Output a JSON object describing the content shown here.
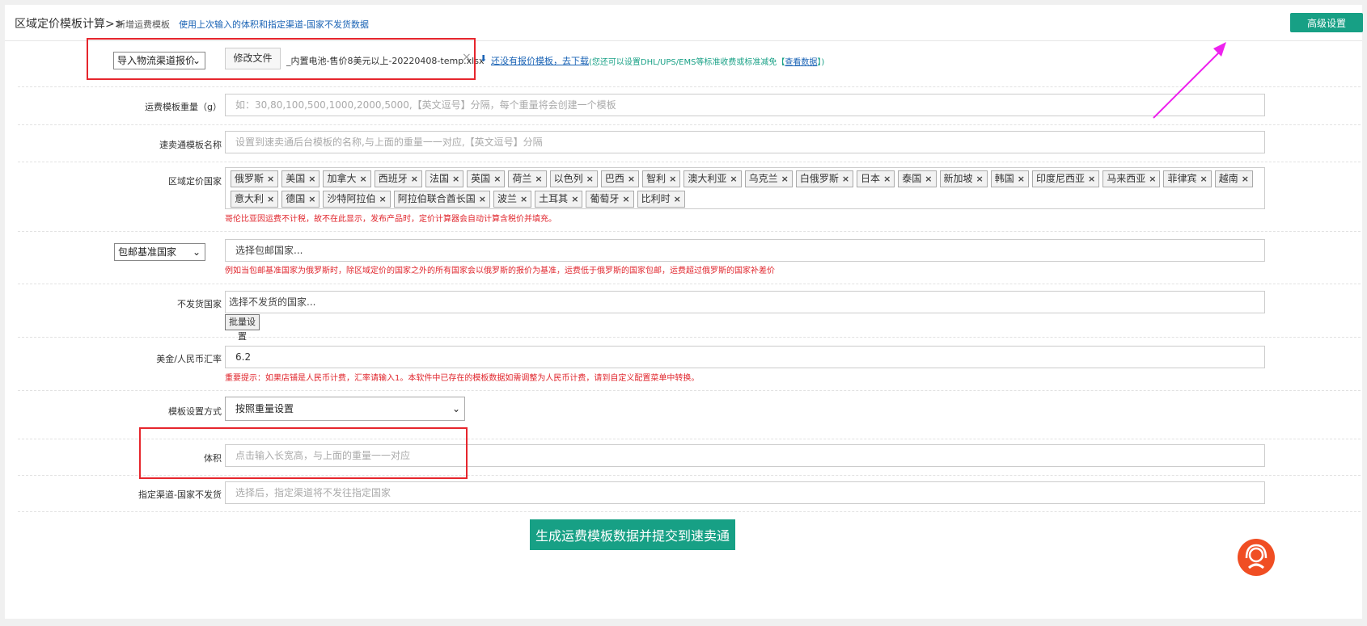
{
  "header": {
    "title": "区域定价模板计算>>",
    "sub": "新增运费模板",
    "note": "使用上次输入的体积和指定渠道-国家不发货数据",
    "advanced_button": "高级设置"
  },
  "import_row": {
    "select_value": "导入物流渠道报价",
    "file_button": "修改文件",
    "file_name": "_内置电池-售价8美元以上-20220408-temp.xlsx",
    "download_link": "还没有报价模板，去下载",
    "tip_prefix": "(您还可以设置DHL/UPS/EMS等标准收费或标准减免【",
    "tip_link": "查看数据",
    "tip_suffix": "】)"
  },
  "weight_row": {
    "label": "运费模板重量（g）",
    "placeholder": "如：30,80,100,500,1000,2000,5000,【英文逗号】分隔，每个重量将会创建一个模板"
  },
  "name_row": {
    "label": "速卖通模板名称",
    "placeholder": "设置到速卖通后台模板的名称,与上面的重量一一对应,【英文逗号】分隔"
  },
  "countries_row": {
    "label": "区域定价国家",
    "tags": [
      "俄罗斯",
      "美国",
      "加拿大",
      "西班牙",
      "法国",
      "英国",
      "荷兰",
      "以色列",
      "巴西",
      "智利",
      "澳大利亚",
      "乌克兰",
      "白俄罗斯",
      "日本",
      "泰国",
      "新加坡",
      "韩国",
      "印度尼西亚",
      "马来西亚",
      "菲律宾",
      "越南",
      "意大利",
      "德国",
      "沙特阿拉伯",
      "阿拉伯联合酋长国",
      "波兰",
      "土耳其",
      "葡萄牙",
      "比利时"
    ],
    "hint": "哥伦比亚因运费不计税，故不在此显示，发布产品时，定价计算器会自动计算含税价并填充。"
  },
  "freeship_row": {
    "select_value": "包邮基准国家",
    "placeholder": "选择包邮国家...",
    "hint": "例如当包邮基准国家为俄罗斯时，除区域定价的国家之外的所有国家会以俄罗斯的报价为基准，运费低于俄罗斯的国家包邮，运费超过俄罗斯的国家补差价"
  },
  "noship_row": {
    "label": "不发货国家",
    "placeholder": "选择不发货的国家...",
    "batch_button": "批量设置"
  },
  "rate_row": {
    "label": "美金/人民币汇率",
    "value": "6.2",
    "hint": "重要提示：如果店铺是人民币计费，汇率请输入1。本软件中已存在的模板数据如需调整为人民币计费，请到自定义配置菜单中转换。"
  },
  "mode_row": {
    "label": "模板设置方式",
    "select_value": "按照重量设置"
  },
  "volume_row": {
    "label": "体积",
    "placeholder": "点击输入长宽高，与上面的重量一一对应"
  },
  "channel_row": {
    "label": "指定渠道-国家不发货",
    "placeholder": "选择后，指定渠道将不发往指定国家"
  },
  "submit_button": "生成运费模板数据并提交到速卖通",
  "colors": {
    "primary": "#17a085",
    "annotation_red": "#e6262d",
    "arrow_magenta": "#ee22ee",
    "hint_red": "#e0262d",
    "link_blue": "#1a63b5"
  },
  "icons": {
    "download": "download-icon",
    "clear": "close-icon",
    "support": "headset-icon"
  }
}
